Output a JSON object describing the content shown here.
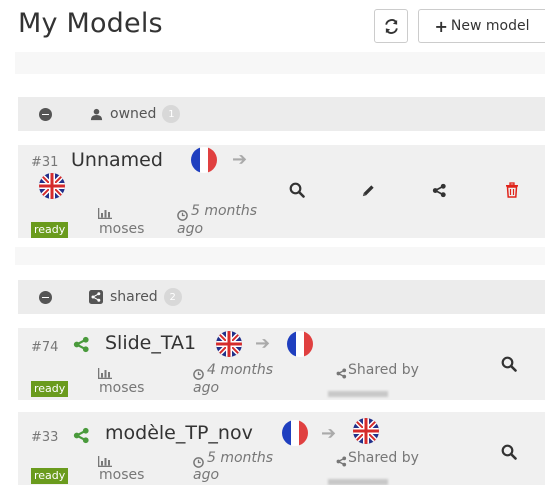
{
  "header": {
    "title": "My Models",
    "refresh_icon": "refresh-icon",
    "new_model_label": "New model",
    "new_model_icon": "plus-icon"
  },
  "sections": {
    "owned": {
      "label": "owned",
      "count": "1",
      "icon": "user-icon"
    },
    "shared": {
      "label": "shared",
      "count": "2",
      "icon": "share-square-icon"
    }
  },
  "models": {
    "m31": {
      "id": "#31",
      "name": "Unnamed",
      "source_lang_flag": "fr-flag-icon",
      "target_lang_flag": "gb-flag-icon",
      "status": "ready",
      "engine": "moses",
      "age": "5 months",
      "age_suffix": "ago"
    },
    "m74": {
      "id": "#74",
      "name": "Slide_TA1",
      "source_lang_flag": "gb-flag-icon",
      "target_lang_flag": "fr-flag-icon",
      "status": "ready",
      "engine": "moses",
      "age": "4 months",
      "age_suffix": "ago",
      "shared_by": "Shared by"
    },
    "m33": {
      "id": "#33",
      "name": "modèle_TP_nov",
      "source_lang_flag": "fr-flag-icon",
      "target_lang_flag": "gb-flag-icon",
      "status": "ready",
      "engine": "moses",
      "age": "5 months",
      "age_suffix": "ago",
      "shared_by": "Shared by"
    }
  },
  "colors": {
    "ready_badge": "#6a9b1d",
    "share_green": "#4a9a3c",
    "delete_red": "#e0241b",
    "section_bg": "#ececec",
    "card_bg": "#f0f0f0"
  }
}
